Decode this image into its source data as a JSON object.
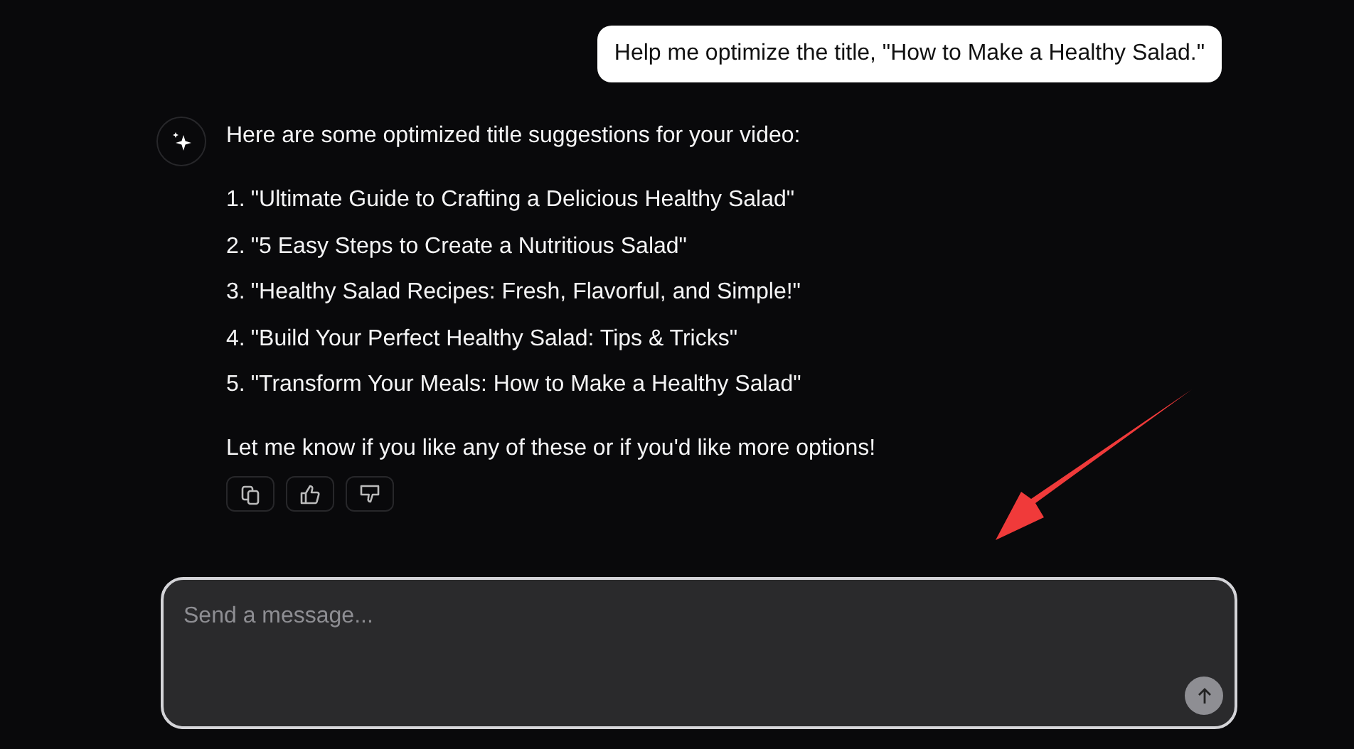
{
  "user_message": "Help me optimize the title, \"How to Make a Healthy Salad.\"",
  "assistant_message": {
    "intro": "Here are some optimized title suggestions for your video:",
    "suggestions": [
      {
        "number": "1.",
        "text": "\"Ultimate Guide to Crafting a Delicious Healthy Salad\""
      },
      {
        "number": "2.",
        "text": "\"5 Easy Steps to Create a Nutritious Salad\""
      },
      {
        "number": "3.",
        "text": "\"Healthy Salad Recipes: Fresh, Flavorful, and Simple!\""
      },
      {
        "number": "4.",
        "text": "\"Build Your Perfect Healthy Salad: Tips & Tricks\""
      },
      {
        "number": "5.",
        "text": "\"Transform Your Meals: How to Make a Healthy Salad\""
      }
    ],
    "closing": "Let me know if you like any of these or if you'd like more options!",
    "actions": [
      {
        "kind": "copy"
      },
      {
        "kind": "upvote"
      },
      {
        "kind": "downvote"
      }
    ]
  },
  "composer": {
    "placeholder": "Send a message..."
  }
}
